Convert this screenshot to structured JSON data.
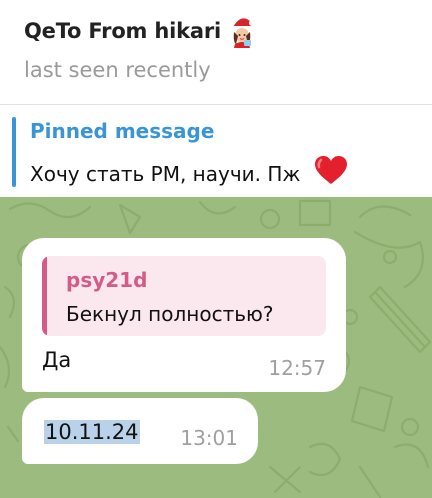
{
  "header": {
    "title": "QeTo From hikari",
    "status": "last seen recently",
    "emoji_icon": "santa-girl-emoji-icon"
  },
  "pinned": {
    "title": "Pinned message",
    "text": "Хочу стать РМ, научи. Пж",
    "icon": "red-heart-icon"
  },
  "messages": [
    {
      "reply_to": {
        "author": "psy21d",
        "text": "Бекнул полностью?"
      },
      "text": "Да",
      "time": "12:57"
    },
    {
      "text": "10.11.24",
      "time": "13:01",
      "selected": true
    }
  ],
  "colors": {
    "accent": "#3a95d5",
    "chat_background": "#9cbb7e",
    "reply_accent": "#d35b86",
    "selection": "#b9d2ea"
  }
}
